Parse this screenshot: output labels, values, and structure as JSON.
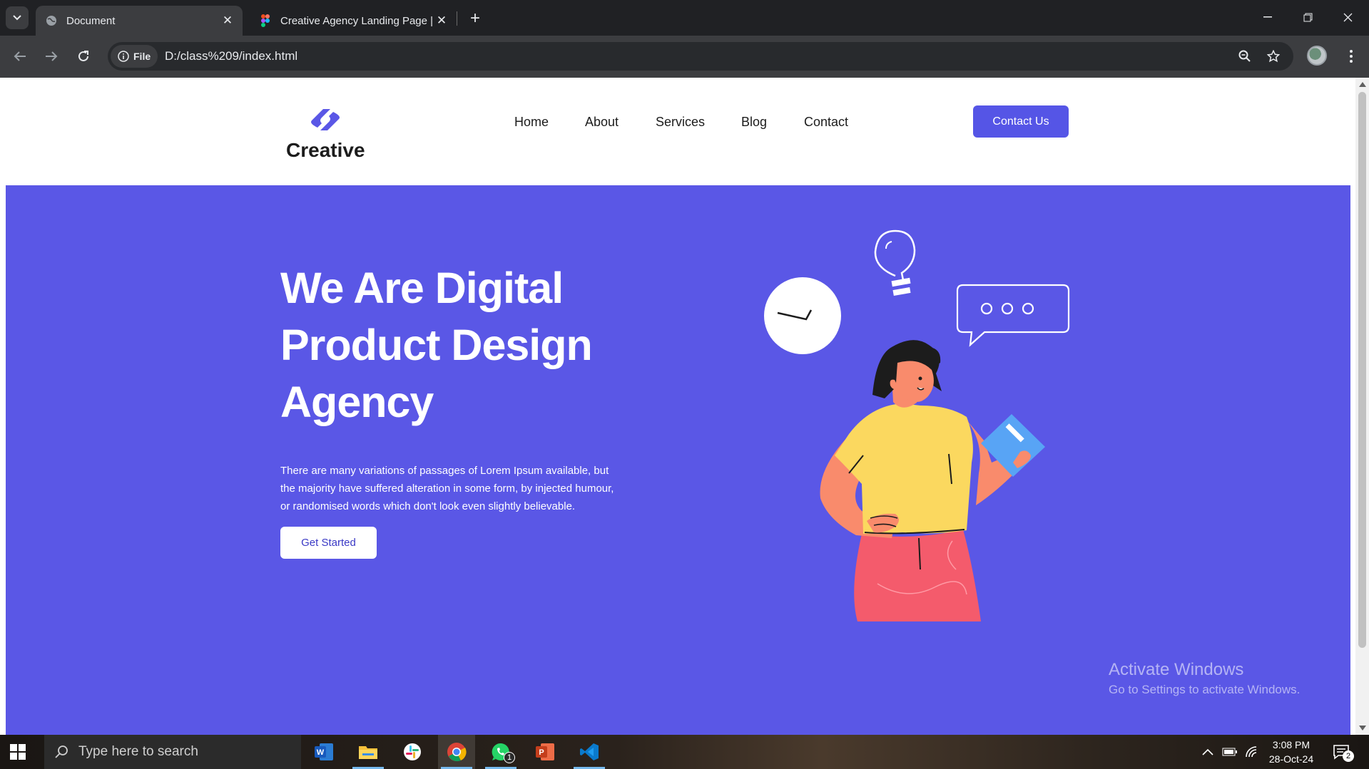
{
  "browser": {
    "tabs": [
      {
        "title": "Document",
        "active": true
      },
      {
        "title": "Creative Agency Landing Page |",
        "active": false
      }
    ],
    "url_chip": "File",
    "url": "D:/class%209/index.html"
  },
  "site": {
    "logo_text": "Creative",
    "nav": [
      "Home",
      "About",
      "Services",
      "Blog",
      "Contact"
    ],
    "cta_label": "Contact Us",
    "hero": {
      "title_lines": [
        "We Are Digital",
        "Product Design",
        "Agency"
      ],
      "text_lines": [
        "There are many variations of passages of Lorem Ipsum available, but",
        "the majority have suffered alteration in some form, by injected humour,",
        "or randomised words which don't look even slightly believable."
      ],
      "button_label": "Get Started"
    },
    "colors": {
      "brand": "#5a57e6",
      "button": "#5555e6"
    }
  },
  "watermark": {
    "title": "Activate Windows",
    "subtitle": "Go to Settings to activate Windows."
  },
  "taskbar": {
    "search_placeholder": "Type here to search",
    "apps": [
      "word-icon",
      "file-explorer-icon",
      "slack-icon",
      "chrome-icon",
      "whatsapp-icon",
      "powerpoint-icon",
      "vscode-icon"
    ],
    "whatsapp_badge": "1",
    "time": "3:08 PM",
    "date": "28-Oct-24",
    "notification_count": "2"
  }
}
